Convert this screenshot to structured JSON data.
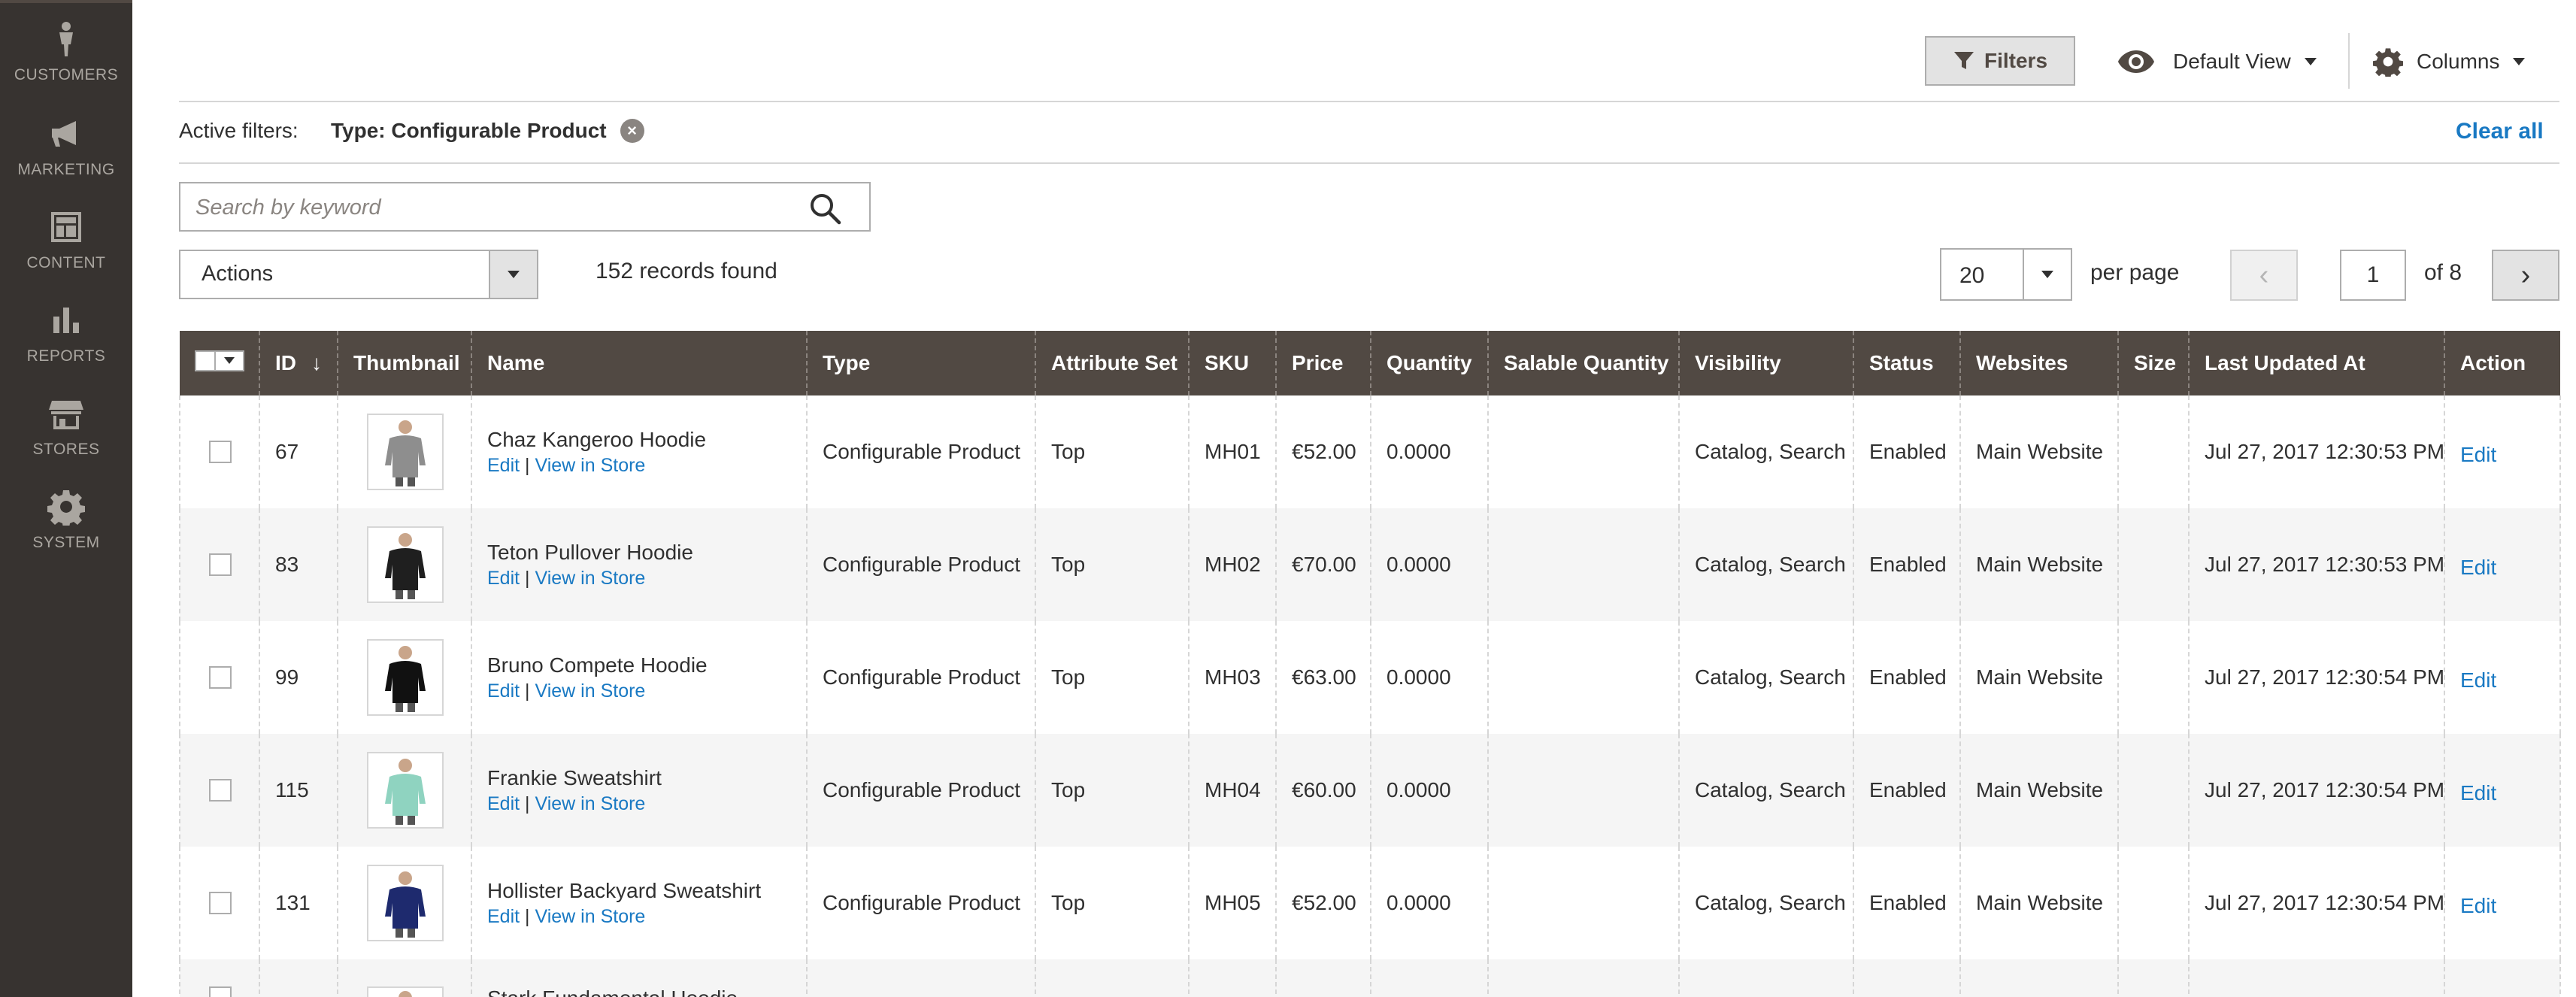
{
  "sidebar": {
    "items": [
      {
        "label": "CUSTOMERS",
        "icon": "person-icon"
      },
      {
        "label": "MARKETING",
        "icon": "megaphone-icon"
      },
      {
        "label": "CONTENT",
        "icon": "layout-icon"
      },
      {
        "label": "REPORTS",
        "icon": "bar-chart-icon"
      },
      {
        "label": "STORES",
        "icon": "storefront-icon"
      },
      {
        "label": "SYSTEM",
        "icon": "gear-icon"
      }
    ]
  },
  "toolbar": {
    "filters_label": "Filters",
    "view_label": "Default View",
    "columns_label": "Columns"
  },
  "active_filters": {
    "label": "Active filters:",
    "chip": "Type: Configurable Product",
    "clear_all": "Clear all"
  },
  "search": {
    "placeholder": "Search by keyword"
  },
  "actions": {
    "label": "Actions"
  },
  "records": "152 records found",
  "pagination": {
    "per_page_value": "20",
    "per_page_label": "per page",
    "current_page": "1",
    "of_label": "of 8"
  },
  "grid": {
    "columns": [
      "ID",
      "Thumbnail",
      "Name",
      "Type",
      "Attribute Set",
      "SKU",
      "Price",
      "Quantity",
      "Salable Quantity",
      "Visibility",
      "Status",
      "Websites",
      "Size",
      "Last Updated At",
      "Action"
    ],
    "sort_indicator": "↓",
    "edit_link": "Edit",
    "view_link": "View in Store",
    "link_separator": "|",
    "action_label": "Edit",
    "rows": [
      {
        "id": "67",
        "name": "Chaz Kangeroo Hoodie",
        "type": "Configurable Product",
        "attribute_set": "Top",
        "sku": "MH01",
        "price": "€52.00",
        "quantity": "0.0000",
        "salable": "",
        "visibility": "Catalog, Search",
        "status": "Enabled",
        "websites": "Main Website",
        "size": "",
        "updated": "Jul 27, 2017 12:30:53 PM",
        "thumb_color": "#8e8e8e"
      },
      {
        "id": "83",
        "name": "Teton Pullover Hoodie",
        "type": "Configurable Product",
        "attribute_set": "Top",
        "sku": "MH02",
        "price": "€70.00",
        "quantity": "0.0000",
        "salable": "",
        "visibility": "Catalog, Search",
        "status": "Enabled",
        "websites": "Main Website",
        "size": "",
        "updated": "Jul 27, 2017 12:30:53 PM",
        "thumb_color": "#1f1f1f"
      },
      {
        "id": "99",
        "name": "Bruno Compete Hoodie",
        "type": "Configurable Product",
        "attribute_set": "Top",
        "sku": "MH03",
        "price": "€63.00",
        "quantity": "0.0000",
        "salable": "",
        "visibility": "Catalog, Search",
        "status": "Enabled",
        "websites": "Main Website",
        "size": "",
        "updated": "Jul 27, 2017 12:30:54 PM",
        "thumb_color": "#111111"
      },
      {
        "id": "115",
        "name": "Frankie Sweatshirt",
        "type": "Configurable Product",
        "attribute_set": "Top",
        "sku": "MH04",
        "price": "€60.00",
        "quantity": "0.0000",
        "salable": "",
        "visibility": "Catalog, Search",
        "status": "Enabled",
        "websites": "Main Website",
        "size": "",
        "updated": "Jul 27, 2017 12:30:54 PM",
        "thumb_color": "#8fd3c0"
      },
      {
        "id": "131",
        "name": "Hollister Backyard Sweatshirt",
        "type": "Configurable Product",
        "attribute_set": "Top",
        "sku": "MH05",
        "price": "€52.00",
        "quantity": "0.0000",
        "salable": "",
        "visibility": "Catalog, Search",
        "status": "Enabled",
        "websites": "Main Website",
        "size": "",
        "updated": "Jul 27, 2017 12:30:54 PM",
        "thumb_color": "#1e2a6e"
      }
    ],
    "partial_row": {
      "name": "Stark Fundamental Hoodie",
      "thumb_color": "#3a3fb0"
    }
  }
}
